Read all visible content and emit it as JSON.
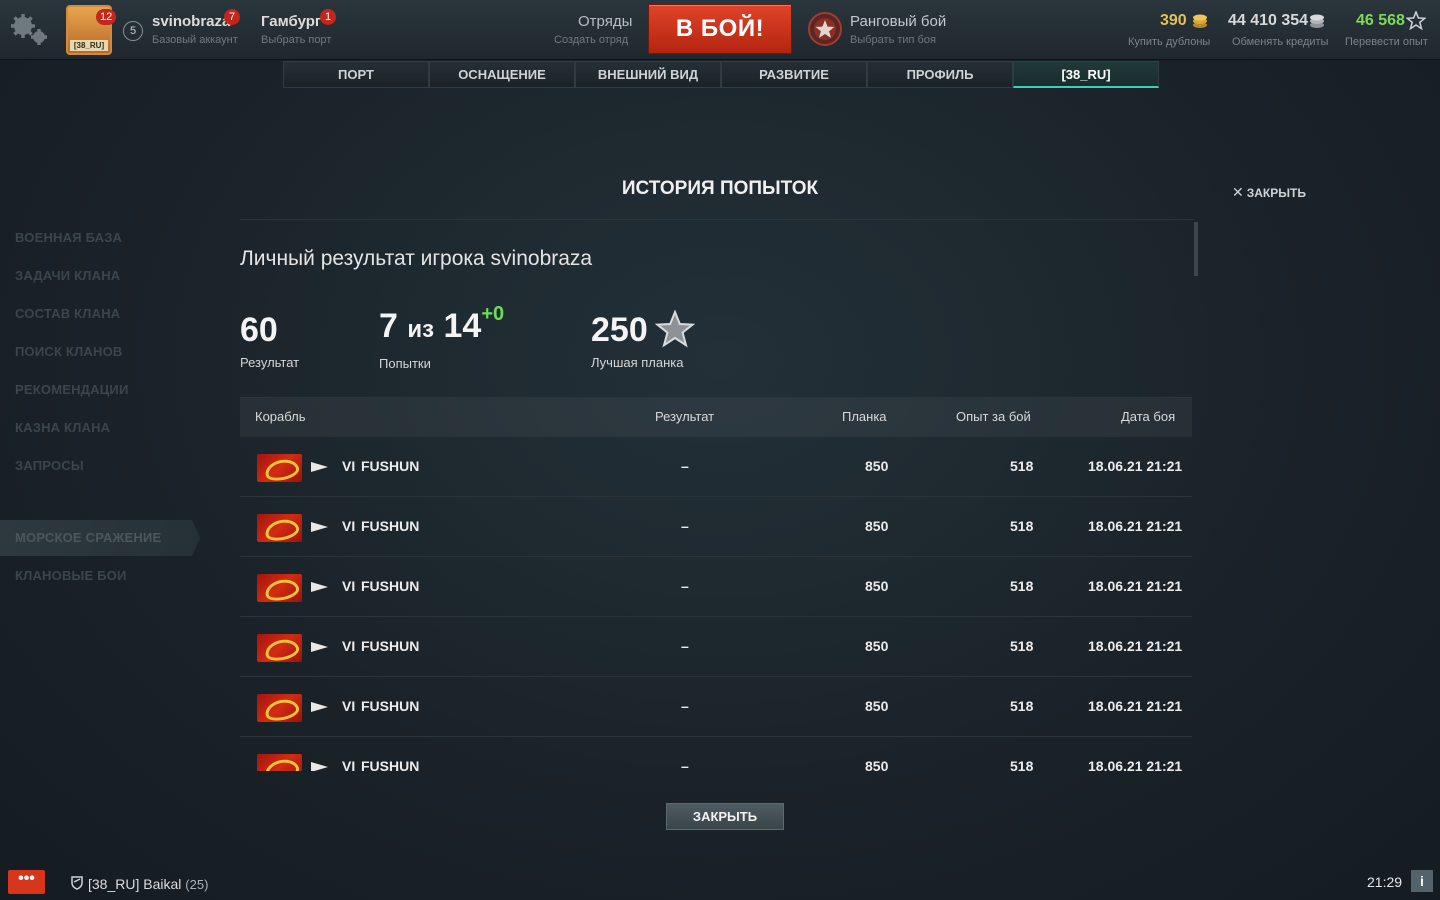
{
  "header": {
    "emblem_count": "12",
    "emblem_tag": "[38_RU]",
    "level": "5",
    "username": "svinobraza",
    "username_badge": "7",
    "account_type": "Базовый аккаунт",
    "port_name": "Гамбург",
    "port_badge": "1",
    "port_sub": "Выбрать порт",
    "squads": "Отряды",
    "squads_sub": "Создать отряд",
    "battle_button": "В БОЙ!",
    "battle_type": "Ранговый бой",
    "battle_type_sub": "Выбрать тип боя",
    "doubloons": "390",
    "doubloons_sub": "Купить дублоны",
    "credits": "44 410 354",
    "credits_sub": "Обменять кредиты",
    "free_xp": "46 568",
    "free_xp_sub": "Перевести опыт",
    "colors": {
      "doubloons": "#e3c05a",
      "credits": "#d9d9d9",
      "free_xp": "#7fd85a",
      "battle": "#d1351d"
    }
  },
  "tabs": [
    "ПОРТ",
    "ОСНАЩЕНИЕ",
    "ВНЕШНИЙ ВИД",
    "РАЗВИТИЕ",
    "ПРОФИЛЬ",
    "[38_RU]"
  ],
  "left_menu": [
    "ВОЕННАЯ БАЗА",
    "ЗАДАЧИ КЛАНА",
    "СОСТАВ КЛАНА",
    "ПОИСК КЛАНОВ",
    "РЕКОМЕНДАЦИИ",
    "КАЗНА КЛАНА",
    "ЗАПРОСЫ",
    "МОРСКОЕ СРАЖЕНИЕ",
    "КЛАНОВЫЕ БОИ"
  ],
  "modal": {
    "title": "ИСТОРИЯ ПОПЫТОК",
    "close_label": "ЗАКРЫТЬ",
    "personal_result": "Личный результат игрока svinobraza",
    "result_value": "60",
    "result_label": "Результат",
    "attempts_used": "7",
    "attempts_sep": "из",
    "attempts_total": "14",
    "attempts_delta": "+0",
    "attempts_label": "Попытки",
    "best_value": "250",
    "best_label": "Лучшая планка",
    "columns": [
      "Корабль",
      "Результат",
      "Планка",
      "Опыт за бой",
      "Дата боя"
    ],
    "rows": [
      {
        "tier": "VI",
        "ship": "FUSHUN",
        "result": "–",
        "bar": "850",
        "xp": "518",
        "date": "18.06.21 21:21"
      },
      {
        "tier": "VI",
        "ship": "FUSHUN",
        "result": "–",
        "bar": "850",
        "xp": "518",
        "date": "18.06.21 21:21"
      },
      {
        "tier": "VI",
        "ship": "FUSHUN",
        "result": "–",
        "bar": "850",
        "xp": "518",
        "date": "18.06.21 21:21"
      },
      {
        "tier": "VI",
        "ship": "FUSHUN",
        "result": "–",
        "bar": "850",
        "xp": "518",
        "date": "18.06.21 21:21"
      },
      {
        "tier": "VI",
        "ship": "FUSHUN",
        "result": "–",
        "bar": "850",
        "xp": "518",
        "date": "18.06.21 21:21"
      },
      {
        "tier": "VI",
        "ship": "FUSHUN",
        "result": "–",
        "bar": "850",
        "xp": "518",
        "date": "18.06.21 21:21"
      }
    ],
    "close_button": "ЗАКРЫТЬ"
  },
  "footer": {
    "chat_label": "•••",
    "division_name": "[38_RU] Baikal",
    "division_level": "(25)",
    "time": "21:29",
    "info_label": "i"
  }
}
